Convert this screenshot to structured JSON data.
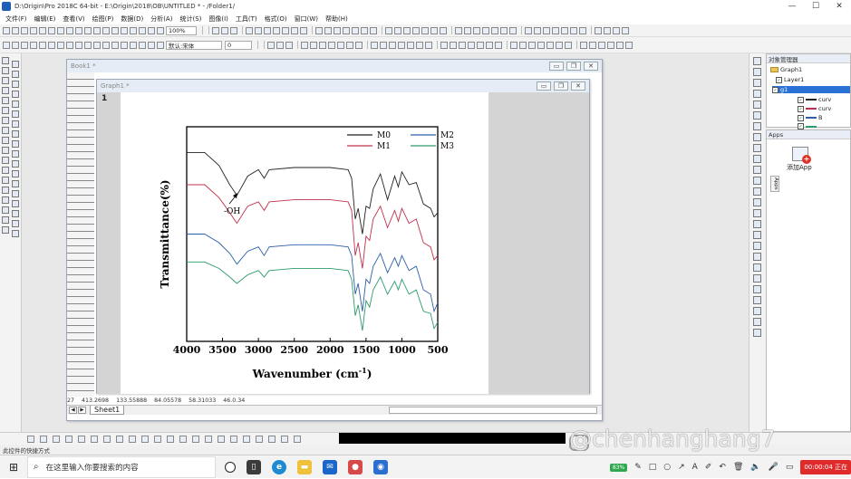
{
  "window": {
    "title": "D:\\Origin\\Pro 2018C 64-bit - E:\\Origin\\2018\\OB\\UNTITLED * - /Folder1/",
    "controls": [
      "—",
      "☐",
      "✕"
    ]
  },
  "menu": [
    "文件(F)",
    "编辑(E)",
    "查看(V)",
    "绘图(P)",
    "数据(D)",
    "分析(A)",
    "统计(S)",
    "图像(I)",
    "工具(T)",
    "格式(O)",
    "窗口(W)",
    "帮助(H)"
  ],
  "toolbar": {
    "zoom_value": "100%",
    "font_name": "默认:宋体",
    "font_size": "0"
  },
  "book1": {
    "title": "Book1 *",
    "status_row": [
      "27",
      "413.2698",
      "133.55888",
      "84.05578",
      "58.31033",
      "46.0.34"
    ],
    "sheet_tab": "Sheet1",
    "nav_buttons": [
      "◀",
      "▶"
    ]
  },
  "graph1": {
    "title": "Graph1 *",
    "layer_label": "1"
  },
  "object_manager": {
    "title": "对象管理器",
    "items": [
      {
        "label": "Graph1",
        "kind": "folder"
      },
      {
        "label": "Layer1",
        "kind": "check"
      },
      {
        "label": "g1",
        "kind": "check"
      },
      {
        "label": "curv",
        "kind": "line",
        "color": "#222222"
      },
      {
        "label": "curv",
        "kind": "line",
        "color": "#c0304a"
      },
      {
        "label": "B",
        "kind": "line",
        "color": "#2c5fa8"
      },
      {
        "label": "",
        "kind": "line",
        "color": "#2c9a6a"
      }
    ]
  },
  "apps": {
    "title": "Apps",
    "add_app_label": "添加App",
    "vertical_tab": "Apps"
  },
  "statusbar": {
    "text": "此控件的快捷方式"
  },
  "taskbar": {
    "search_placeholder": "在这里输入你要搜索的内容",
    "battery": "83%",
    "rec_timer": "00:00:04 正在"
  },
  "watermark": {
    "text": "@chenhanghang7"
  },
  "chart_data": {
    "type": "line",
    "xlabel": "Wavenumber (cm-1)",
    "ylabel": "Transmittance(%)",
    "xlim": [
      4000,
      500
    ],
    "x_ticks": [
      4000,
      3500,
      3000,
      2500,
      2000,
      1500,
      1000,
      500
    ],
    "ylim": [
      0,
      100
    ],
    "annotation": "-OH",
    "legend_position": "top-right",
    "series": [
      {
        "name": "M0",
        "color": "#222222",
        "x": [
          4000,
          3750,
          3550,
          3400,
          3300,
          3150,
          3000,
          2920,
          2850,
          2500,
          2000,
          1750,
          1700,
          1650,
          1610,
          1550,
          1500,
          1450,
          1400,
          1300,
          1200,
          1100,
          1050,
          1000,
          900,
          800,
          700,
          600,
          550,
          500
        ],
        "y": [
          88,
          88,
          82,
          73,
          68,
          77,
          80,
          76,
          80,
          81,
          81,
          80,
          76,
          57,
          62,
          50,
          63,
          62,
          71,
          78,
          66,
          77,
          72,
          79,
          73,
          74,
          64,
          62,
          58,
          60
        ]
      },
      {
        "name": "M1",
        "color": "#c0304a",
        "x": [
          4000,
          3750,
          3550,
          3400,
          3300,
          3150,
          3000,
          2920,
          2850,
          2500,
          2000,
          1750,
          1700,
          1650,
          1610,
          1550,
          1500,
          1450,
          1400,
          1300,
          1200,
          1100,
          1050,
          1000,
          900,
          800,
          700,
          600,
          550,
          500
        ],
        "y": [
          73,
          73,
          67,
          60,
          55,
          63,
          65,
          61,
          65,
          66,
          66,
          65,
          61,
          40,
          46,
          34,
          49,
          47,
          57,
          63,
          53,
          61,
          56,
          62,
          55,
          57,
          46,
          44,
          38,
          40
        ]
      },
      {
        "name": "M2",
        "color": "#2c5fa8",
        "x": [
          4000,
          3750,
          3550,
          3400,
          3300,
          3150,
          3000,
          2920,
          2850,
          2500,
          2000,
          1750,
          1700,
          1650,
          1610,
          1550,
          1500,
          1450,
          1400,
          1300,
          1200,
          1100,
          1050,
          1000,
          900,
          800,
          700,
          600,
          550,
          500
        ],
        "y": [
          50,
          50,
          46,
          41,
          36,
          42,
          44,
          40,
          44,
          45,
          45,
          44,
          40,
          22,
          27,
          14,
          29,
          27,
          35,
          41,
          32,
          39,
          35,
          40,
          33,
          35,
          24,
          22,
          14,
          18
        ]
      },
      {
        "name": "M3",
        "color": "#2c9a6a",
        "x": [
          4000,
          3750,
          3550,
          3400,
          3300,
          3150,
          3000,
          2920,
          2850,
          2500,
          2000,
          1750,
          1700,
          1650,
          1610,
          1550,
          1500,
          1450,
          1400,
          1300,
          1200,
          1100,
          1050,
          1000,
          900,
          800,
          700,
          600,
          550,
          500
        ],
        "y": [
          37,
          37,
          34,
          30,
          27,
          31,
          33,
          30,
          33,
          34,
          34,
          33,
          29,
          12,
          17,
          5,
          19,
          16,
          24,
          30,
          22,
          28,
          24,
          29,
          22,
          24,
          14,
          13,
          6,
          9
        ]
      }
    ]
  }
}
